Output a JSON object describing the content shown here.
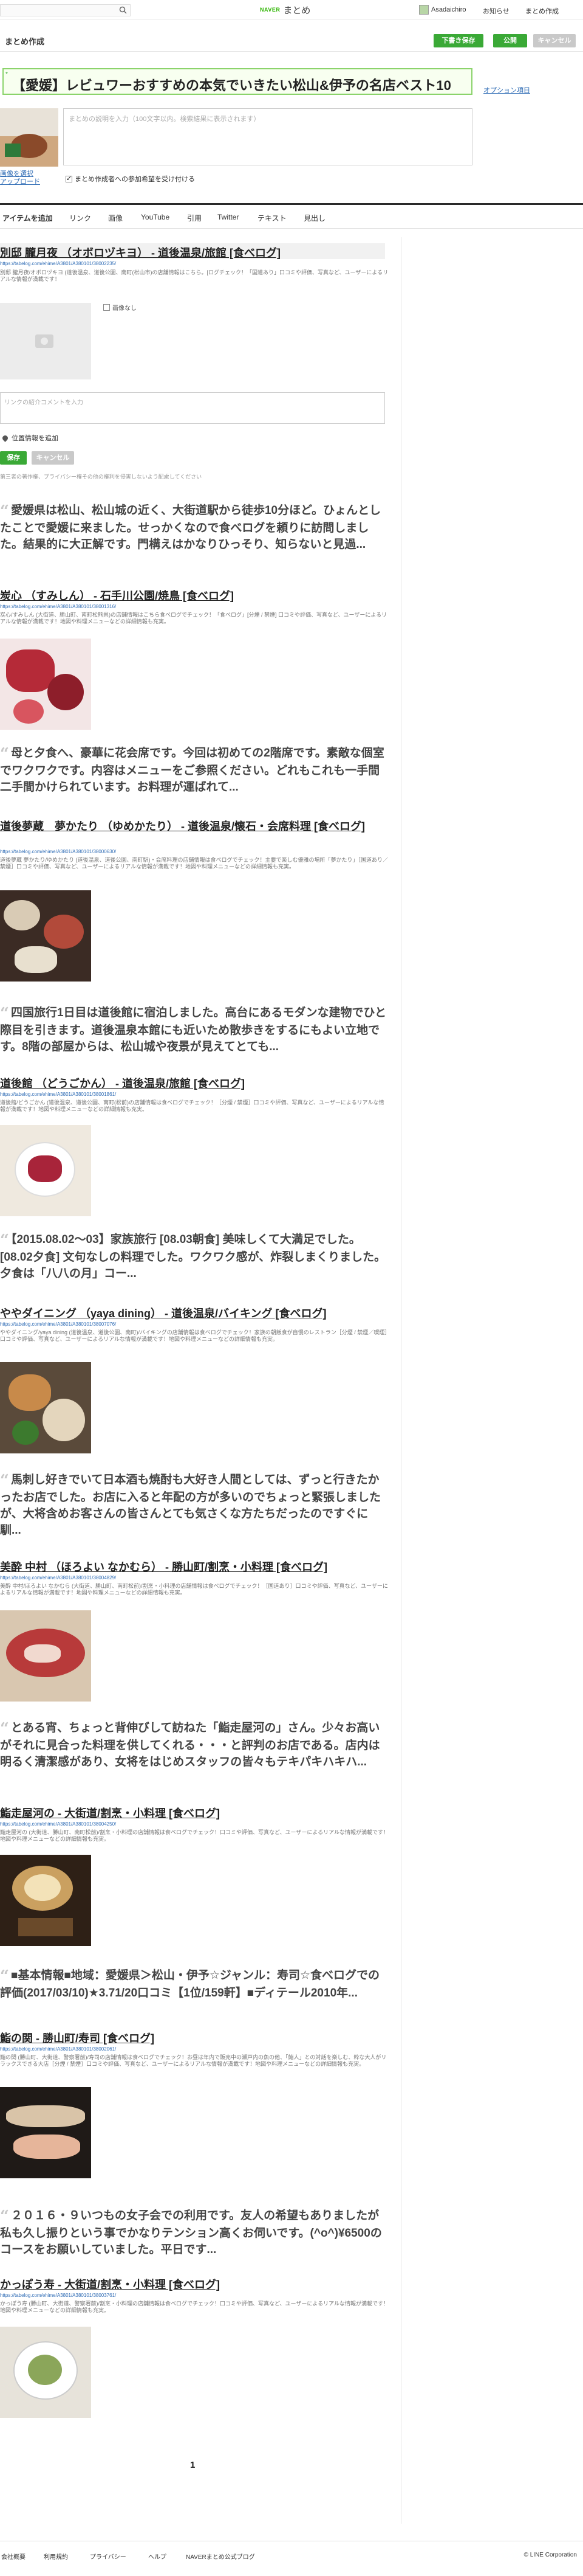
{
  "header": {
    "logo_naver": "NAVER",
    "logo_matome": "まとめ",
    "username": "Asadaichiro",
    "nav": [
      "お知らせ",
      "まとめ作成"
    ]
  },
  "subheader": {
    "title": "まとめ作成",
    "draft_button": "下書き保存",
    "publish_button": "公開",
    "cancel_button": "キャンセル"
  },
  "editor": {
    "title_value": "【愛媛】レビュワーおすすめの本気でいきたい松山&伊予の名店ベスト10",
    "title_required_mark": "*",
    "options_link": "オプション項目",
    "thumb_links": [
      "画像を選択",
      "アップロード"
    ],
    "desc_placeholder": "まとめの説明を入力（100文字以内。検索結果に表示されます）",
    "collab_label": "まとめ作成者への参加希望を受け付ける"
  },
  "tabs": [
    "アイテムを追加",
    "リンク",
    "画像",
    "YouTube",
    "引用",
    "Twitter",
    "テキスト",
    "見出し"
  ],
  "item_editor": {
    "no_image_label": "画像なし",
    "comment_placeholder": "リンクの紹介コメントを入力",
    "location_label": "位置情報を追加",
    "save_button": "保存",
    "cancel_button": "キャンセル",
    "note": "第三者の著作権、プライバシー権その他の権利を侵害しないよう配慮してください"
  },
  "items": [
    {
      "title": "別邸 朧月夜 （オボロヅキヨ） - 道後温泉/旅館 [食べログ]",
      "url": "https://tabelog.com/ehime/A3801/A380101/38002235/",
      "desc": "別邸 朧月夜/オボロヅキヨ (道後温泉、道後公園、南町(松山市)の店舗情報はこちら。[ログチェック！「国道あり」口コミや評価、写真など、ユーザーによるリアルな情報が満載です！",
      "quote": "愛媛県は松山、松山城の近く、大街道駅から徒歩10分ほど。ひょんとしたことで愛媛に来ました。せっかくなので食べログを頼りに訪問しました。結果的に大正解です。門構えはかなりひっそり、知らないと見過..."
    },
    {
      "title": "炭心 （すみしん） - 石手川公園/焼鳥 [食べログ]",
      "url": "https://tabelog.com/ehime/A3801/A380101/38001316/",
      "desc": "炭心/すみしん (大街道、勝山町、南町松熊県)の店舗情報はこちら食べログでチェック！「食べログ」[分煙 / 禁煙] 口コミや評価、写真など、ユーザーによるリアルな情報が満載です！地図や料理メニューなどの詳細情報も充実。",
      "quote": "母と夕食へ、豪華に花会席です。今回は初めての2階席です。素敵な個室でワクワクです。内容はメニューをご参照ください。どれもこれも一手間二手間かけられています。お料理が運ばれて..."
    },
    {
      "title": "道後夢蔵　夢かたり （ゆめかたり） - 道後温泉/懐石・会席料理 [食べログ]",
      "url": "https://tabelog.com/ehime/A3801/A380101/38000630/",
      "desc": "道後夢蔵 夢かたり/ゆめかたり (道後温泉、道後公園、南町駅)・会席料理の店舗情報は食べログでチェック！主要で楽しむ優雅の場所「夢かたり」［国道あり／禁煙］口コミや評価、写真など、ユーザーによるリアルな情報が満載です！地図や料理メニューなどの詳細情報も充実。",
      "quote": "四国旅行1日目は道後館に宿泊しました。高台にあるモダンな建物でひと際目を引きます。道後温泉本館にも近いため散歩きをするにもよい立地です。8階の部屋からは、松山城や夜景が見えてとても..."
    },
    {
      "title": "道後館 （どうごかん） - 道後温泉/旅館 [食べログ]",
      "url": "https://tabelog.com/ehime/A3801/A380101/38001861/",
      "desc": "道後館/どうごかん (道後温泉、道後公園、南町(松前)の店舗情報は食べログでチェック！［分煙 / 禁煙］口コミや評価、写真など、ユーザーによるリアルな情報が満載です！地図や料理メニューなどの詳細情報も充実。",
      "quote": "【2015.08.02〜03】家族旅行 [08.03朝食] 美味しくて大満足でした。[08.02夕食] 文句なしの料理でした。ワクワク感が、炸裂しまくりました。夕食は「八八の月」コー..."
    },
    {
      "title": "ややダイニング （yaya dining） - 道後温泉/バイキング [食べログ]",
      "url": "https://tabelog.com/ehime/A3801/A380101/38007076/",
      "desc": "ややダイニング/yaya dining (道後温泉、道後公園、南町)/バイキングの店舗情報は食べログでチェック！家族の朝飯食が自慢のレストラン［分煙 / 禁煙／喫煙］口コミや評価、写真など、ユーザーによるリアルな情報が満載です！地図や料理メニューなどの詳細情報も充実。",
      "quote": "馬刺し好きでいて日本酒も焼酎も大好き人間としては、ずっと行きたかったお店でした。お店に入ると年配の方が多いのでちょっと緊張しましたが、大将含めお客さんの皆さんとても気さくな方たちだったのですぐに馴..."
    },
    {
      "title": "美酔 中村 （ほろよい なかむら） - 勝山町/割烹・小料理 [食べログ]",
      "url": "https://tabelog.com/ehime/A3801/A380101/38004829/",
      "desc": "美酔 中村/ほろよい なかむら (大街道、勝山町、南町松前)/割烹・小料理の店舗情報は食べログでチェック！［国道あり］口コミや評価、写真など、ユーザーによるリアルな情報が満載です！地図や料理メニューなどの詳細情報も充実。",
      "quote": "とある宵、ちょっと背伸びして訪ねた「鮨走屋河の」さん。少々お高いがそれに見合った料理を供してくれる・・・と評判のお店である。店内は明るく清潔感があり、女将をはじめスタッフの皆々もテキパキハキハ..."
    },
    {
      "title": "鮨走屋河の - 大街道/割烹・小料理 [食べログ]",
      "url": "https://tabelog.com/ehime/A3801/A380101/38004250/",
      "desc": "鮨走屋河の (大街道、勝山町、南町松前)/割烹・小料理の店舗情報は食べログでチェック！口コミや評価、写真など、ユーザーによるリアルな情報が満載です！地図や料理メニューなどの詳細情報も充実。",
      "quote": "■基本情報■地域：愛媛県＞松山・伊予☆ジャンル：寿司☆食べログでの評価(2017/03/10)★3.71/20口コミ【1位/159軒】■ディテール2010年..."
    },
    {
      "title": "鮨の関 - 勝山町/寿司 [食べログ]",
      "url": "https://tabelog.com/ehime/A3801/A380101/38002061/",
      "desc": "鮨の関 (勝山町、大街道、警察署前)/寿司の店舗情報は食べログでチェック！お昼は年内で販売中の瀬戸内の魚の他、「鮨人」との対話を楽しむ、粋な大人がリラックスできる大店［分煙 / 禁煙］口コミや評価、写真など、ユーザーによるリアルな情報が満載です！地図や料理メニューなどの詳細情報も充実。",
      "quote": "２０１６・９いつもの女子会での利用です。友人の希望もありましたが私も久し振りという事でかなりテンション高くお伺いです。(^o^)¥6500のコースをお願いしていました。平日です..."
    },
    {
      "title": "かっぽう寿 - 大街道/割烹・小料理 [食べログ]",
      "url": "https://tabelog.com/ehime/A3801/A380101/38003761/",
      "desc": "かっぽう寿 (勝山町、大街道、警察署前)/割烹・小料理の店舗情報は食べログでチェック！口コミや評価、写真など、ユーザーによるリアルな情報が満載です！地図や料理メニューなどの詳細情報も充実。",
      "quote": ""
    }
  ],
  "pager": "1",
  "footer": {
    "links": [
      "会社概要",
      "利用規約",
      "プライバシー",
      "ヘルプ",
      "NAVERまとめ公式ブログ"
    ],
    "corp": "© LINE Corporation"
  },
  "colors": {
    "accent_green": "#3aa936",
    "link_blue": "#2f6cb5"
  }
}
